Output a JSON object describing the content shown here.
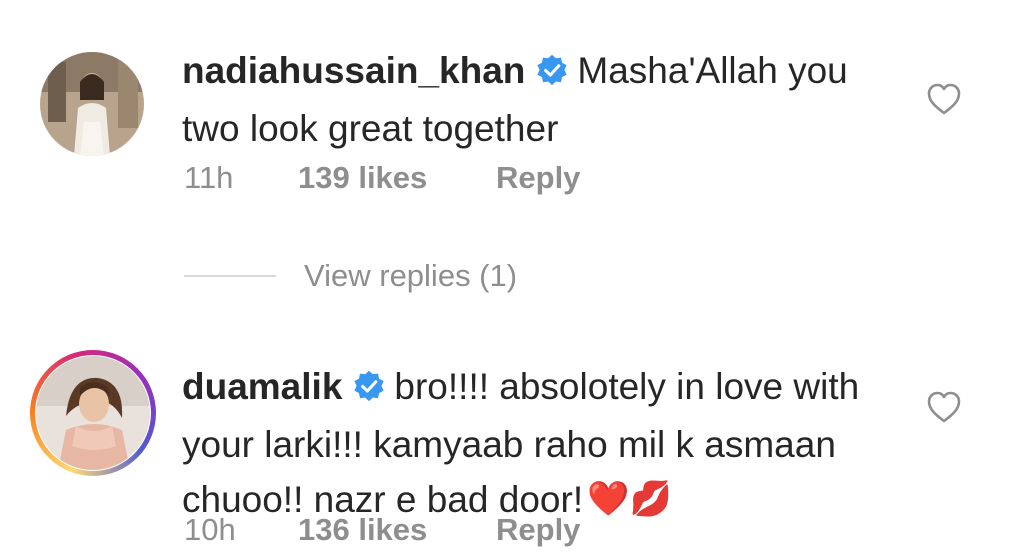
{
  "comments": [
    {
      "username": "nadiahussain_khan",
      "verified": true,
      "text": "Masha'Allah you two look great together",
      "time": "11h",
      "likes": "139 likes",
      "reply_label": "Reply",
      "view_replies": "View replies (1)"
    },
    {
      "username": "duamalik",
      "verified": true,
      "text": "bro!!!! absolotely in love with your larki!!! kamyaab raho mil k asmaan chuoo!! nazr e bad door!",
      "emojis": "❤️💋",
      "time": "10h",
      "likes": "136 likes",
      "reply_label": "Reply",
      "story_ring": true
    }
  ],
  "icons": {
    "verified": "verified-badge-icon",
    "like": "heart-outline-icon"
  },
  "colors": {
    "verified": "#3897f0",
    "secondary_text": "#8e8e8e",
    "primary_text": "#262626"
  }
}
